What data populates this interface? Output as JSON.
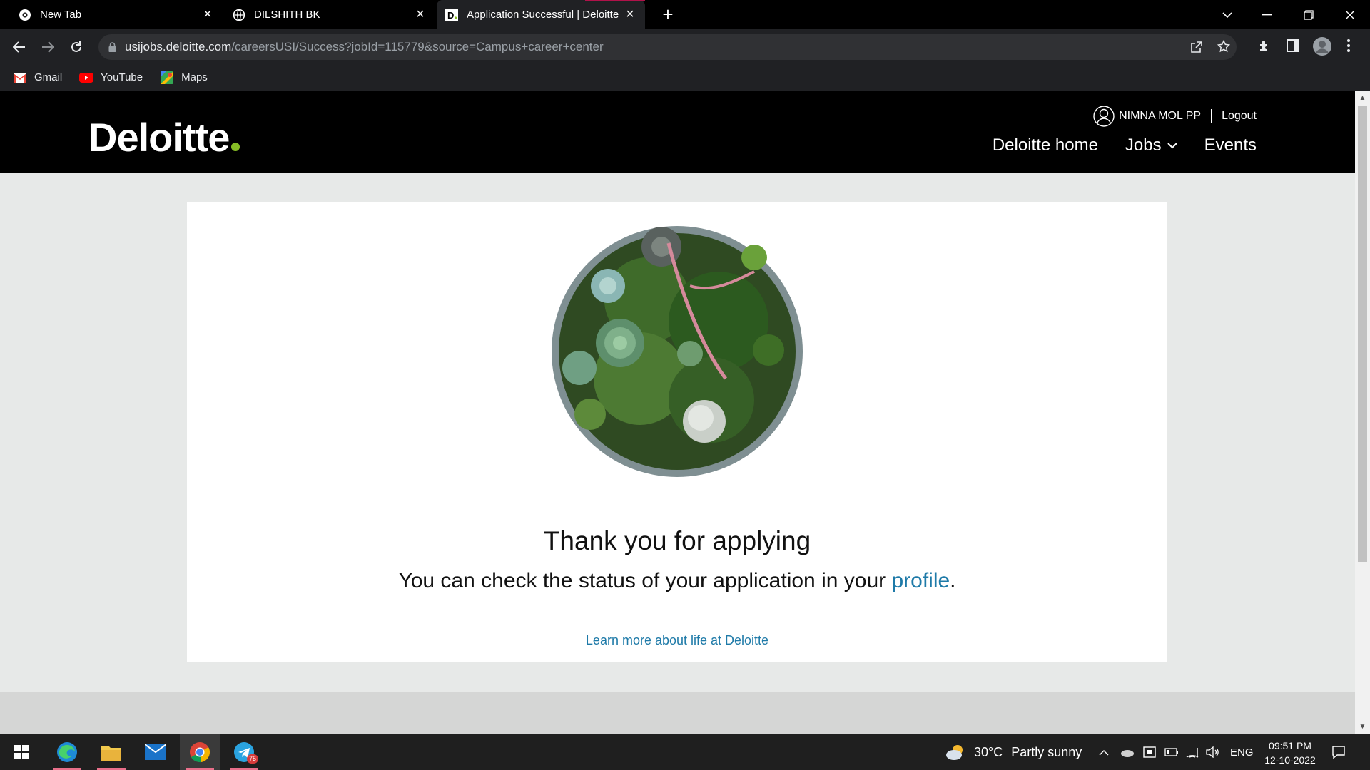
{
  "browser": {
    "tabs": [
      {
        "title": "New Tab",
        "icon": "chrome-icon"
      },
      {
        "title": "DILSHITH BK",
        "icon": "globe-icon"
      },
      {
        "title": "Application Successful | Deloitte |",
        "icon": "deloitte-favicon"
      }
    ],
    "new_tab_symbol": "+",
    "url_host": "usijobs.deloitte.com",
    "url_rest": "/careersUSI/Success?jobId=115779&source=Campus+career+center",
    "bookmarks": [
      {
        "label": "Gmail",
        "icon": "gmail-icon"
      },
      {
        "label": "YouTube",
        "icon": "youtube-icon"
      },
      {
        "label": "Maps",
        "icon": "maps-icon"
      }
    ]
  },
  "site": {
    "logo": "Deloitte",
    "logo_accent": "#86bc25",
    "user_name": "NIMNA MOL PP",
    "logout_label": "Logout",
    "nav": [
      {
        "label": "Deloitte home"
      },
      {
        "label": "Jobs"
      },
      {
        "label": "Events"
      }
    ]
  },
  "content": {
    "heading": "Thank you for applying",
    "status_prefix": "You can check the status of your application in your ",
    "status_link": "profile",
    "status_suffix": ".",
    "learn_more": "Learn more about life at Deloitte",
    "link_color": "#1e7aa8"
  },
  "taskbar": {
    "weather_temp": "30°C",
    "weather_desc": "Partly sunny",
    "language": "ENG",
    "time": "09:51 PM",
    "date": "12-10-2022",
    "telegram_badge": "75"
  }
}
